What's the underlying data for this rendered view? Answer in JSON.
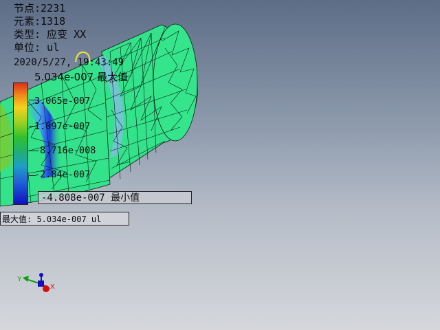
{
  "info": {
    "nodes": "节点:2231",
    "elements": "元素:1318",
    "type": "类型: 应变 XX",
    "unit": "单位: ul",
    "timestamp": "2020/5/27, 19:43:49"
  },
  "legend": {
    "max_label": "5.034e-007 最大值",
    "labels": [
      "3.065e-007",
      "1.097e-007",
      "-8.716e-008",
      "-2.84e-007"
    ],
    "min_label": "-4.808e-007 最小值"
  },
  "probes": {
    "min_probe_text": "-4.808e-007 最小值",
    "max_probe_text": "最大值: 5.034e-007 ul"
  },
  "triad": {
    "x_label": "X",
    "y_label": "Y",
    "x_color": "#d01010",
    "y_color": "#10a010",
    "z_color": "#1010c0"
  },
  "colors": {
    "mesh_fill": "#33e28a",
    "mesh_line": "#0b1a10",
    "accent_blue": "#1a3fd8"
  }
}
